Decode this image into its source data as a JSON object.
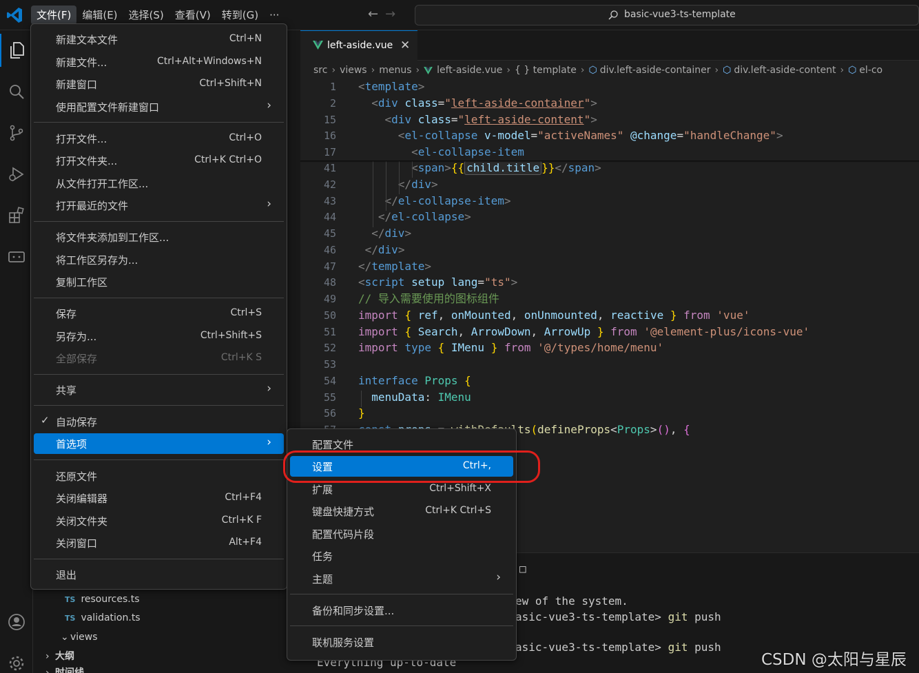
{
  "menubar": {
    "items": [
      "文件(F)",
      "编辑(E)",
      "选择(S)",
      "查看(V)",
      "转到(G)",
      "···"
    ]
  },
  "command_center": {
    "text": "basic-vue3-ts-template"
  },
  "tab": {
    "name": "left-aside.vue",
    "close": "✕"
  },
  "breadcrumb": {
    "items": [
      "src",
      "views",
      "menus",
      "left-aside.vue",
      "{ } template",
      "div.left-aside-container",
      "div.left-aside-content",
      "el-co"
    ]
  },
  "file_menu": {
    "items": [
      {
        "label": "新建文本文件",
        "kb": "Ctrl+N"
      },
      {
        "label": "新建文件...",
        "kb": "Ctrl+Alt+Windows+N"
      },
      {
        "label": "新建窗口",
        "kb": "Ctrl+Shift+N"
      },
      {
        "label": "使用配置文件新建窗口",
        "sub": "›"
      },
      {
        "label": "打开文件...",
        "kb": "Ctrl+O"
      },
      {
        "label": "打开文件夹...",
        "kb": "Ctrl+K Ctrl+O"
      },
      {
        "label": "从文件打开工作区...",
        "kb": ""
      },
      {
        "label": "打开最近的文件",
        "sub": "›"
      },
      {
        "label": "将文件夹添加到工作区...",
        "kb": ""
      },
      {
        "label": "将工作区另存为...",
        "kb": ""
      },
      {
        "label": "复制工作区",
        "kb": ""
      },
      {
        "label": "保存",
        "kb": "Ctrl+S"
      },
      {
        "label": "另存为...",
        "kb": "Ctrl+Shift+S"
      },
      {
        "label": "全部保存",
        "kb": "Ctrl+K S"
      },
      {
        "label": "共享",
        "sub": "›"
      },
      {
        "label": "自动保存",
        "check": "✓"
      },
      {
        "label": "首选项",
        "sub": "›"
      },
      {
        "label": "还原文件",
        "kb": ""
      },
      {
        "label": "关闭编辑器",
        "kb": "Ctrl+F4"
      },
      {
        "label": "关闭文件夹",
        "kb": "Ctrl+K F"
      },
      {
        "label": "关闭窗口",
        "kb": "Alt+F4"
      },
      {
        "label": "退出",
        "kb": ""
      }
    ]
  },
  "pref_menu": {
    "items": [
      {
        "label": "配置文件",
        "kb": ""
      },
      {
        "label": "设置",
        "kb": "Ctrl+,"
      },
      {
        "label": "扩展",
        "kb": "Ctrl+Shift+X"
      },
      {
        "label": "键盘快捷方式",
        "kb": "Ctrl+K Ctrl+S"
      },
      {
        "label": "配置代码片段",
        "kb": ""
      },
      {
        "label": "任务",
        "kb": ""
      },
      {
        "label": "主题",
        "sub": "›"
      },
      {
        "label": "备份和同步设置...",
        "kb": ""
      },
      {
        "label": "联机服务设置",
        "kb": ""
      }
    ]
  },
  "sidebar": {
    "files": [
      "resources.ts",
      "validation.ts"
    ],
    "folder": "views",
    "sections": [
      "大纲",
      "时间线"
    ],
    "ts_badge": "TS"
  },
  "editor": {
    "line_numbers": [
      "1",
      "2",
      "15",
      "16",
      "17",
      "41",
      "42",
      "43",
      "44",
      "45",
      "46",
      "47",
      "48",
      "49",
      "50",
      "51",
      "52",
      "53",
      "54",
      "55",
      "56",
      "57"
    ],
    "inline_chip": "child.title"
  },
  "terminal": {
    "lines": [
      "ew of the system.",
      "asic-vue3-ts-template> ",
      "asic-vue3-ts-template> ",
      "Everything up-to-date"
    ],
    "cmd1": "git",
    "arg1": "push",
    "cmd2": "git",
    "arg2": "push"
  },
  "watermark": "CSDN @太阳与星辰",
  "colors": {
    "accent": "#0078d4",
    "highlight_ring": "#e0201c"
  }
}
